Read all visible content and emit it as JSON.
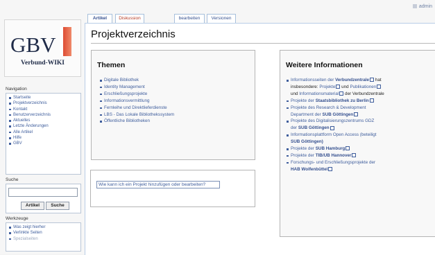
{
  "user": {
    "label": "admin"
  },
  "tabs": [
    {
      "label": "Artikel"
    },
    {
      "label": "Diskussion"
    },
    {
      "label": "bearbeiten"
    },
    {
      "label": "Versionen"
    }
  ],
  "logo": {
    "text": "GBV",
    "subtitle": "Verbund-WIKI"
  },
  "navigation": {
    "title": "Navigation",
    "items": [
      "Startseite",
      "Projektverzeichnis",
      "Kontakt",
      "Benutzerverzeichnis",
      "Aktuelles",
      "Letzte Änderungen",
      "Alle Artikel",
      "Hilfe",
      "GBV"
    ]
  },
  "search": {
    "title": "Suche",
    "value": "",
    "article_button": "Artikel",
    "search_button": "Suche"
  },
  "tools": {
    "title": "Werkzeuge",
    "items": [
      "Was zeigt hierher",
      "Verlinkte Seiten",
      "Spezialseiten"
    ]
  },
  "page": {
    "title": "Projektverzeichnis"
  },
  "themen": {
    "heading": "Themen",
    "items": [
      "Digitale Bibliothek",
      "Identity Management",
      "Erschließungsprojekte",
      "Informationsvermittlung",
      "Fernleihe und Direktlieferdienste",
      "LBS - Das Lokale Bibliothekssystem",
      "Öffentliche Bibliotheken"
    ]
  },
  "link_box": {
    "text": "Wie kann ich ein Projekt hinzufügen oder bearbeiten?"
  },
  "weitere": {
    "heading": "Weitere Informationen",
    "items": [
      {
        "a": "Informationsseiten der ",
        "b": "Verbundzentrale",
        "c": " hat"
      },
      {
        "a": "insbesondere: ",
        "b": "Projekte",
        "c": " und ",
        "d": "Publikationen"
      },
      {
        "a": "und ",
        "b": "Informationsmaterial",
        "c": " der Verbundzentrale"
      },
      {
        "a": "Projekte der ",
        "b": "Staatsbibliothek zu Berlin"
      },
      {
        "a": "Projekte des Research & Development"
      },
      {
        "a": "Department der ",
        "b": "SUB Göttingen"
      },
      {
        "a": "Projekte des Digitalisierungszentrums GDZ"
      },
      {
        "a": "der ",
        "b": "SUB Göttingen"
      },
      {
        "a": "Informationsplattform Open Access (beteiligt"
      },
      {
        "a": "SUB Göttingen)"
      },
      {
        "a": "Projekte der ",
        "b": "SUB Hamburg"
      },
      {
        "a": "Projekte der ",
        "b": "TIB/UB Hannover"
      },
      {
        "a": "Forschungs- und Erschließungsprojekte der"
      },
      {
        "a": "HAB Wolfenbüttel"
      }
    ]
  }
}
